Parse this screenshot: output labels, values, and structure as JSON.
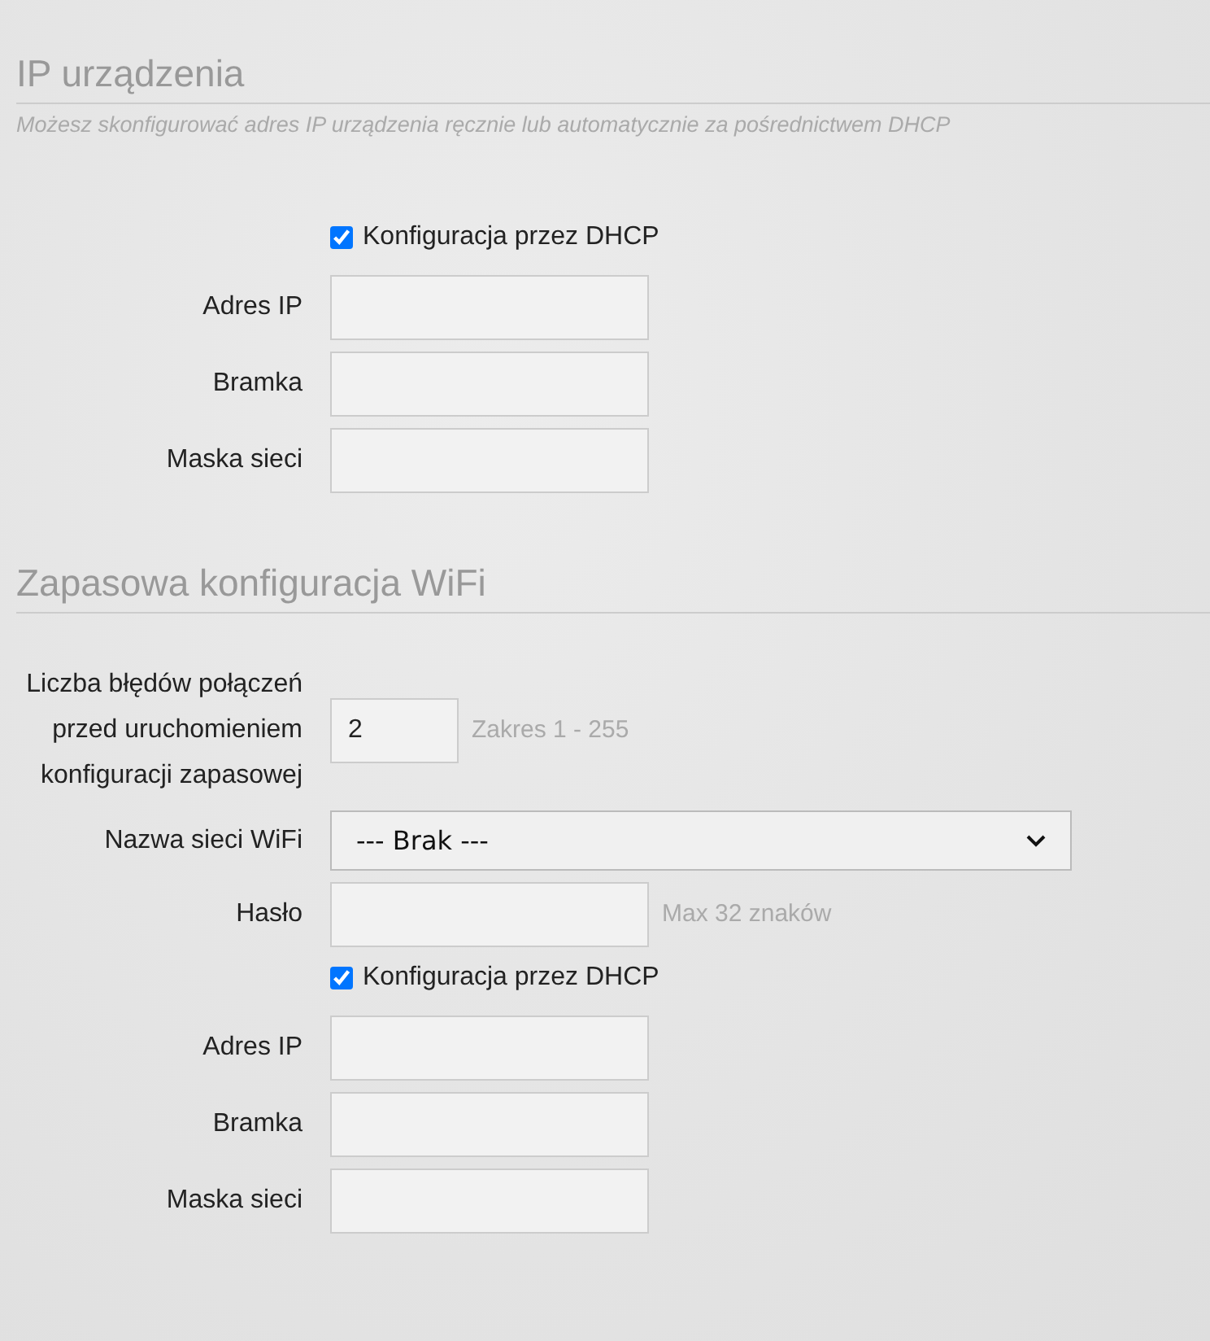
{
  "sections": [
    {
      "title": "IP urządzenia",
      "description": "Możesz skonfigurować adres IP urządzenia ręcznie lub automatycznie za pośrednictwem DHCP",
      "rows": [
        {
          "kind": "checkbox",
          "label": "Konfiguracja przez DHCP",
          "checked": true
        },
        {
          "kind": "text",
          "label": "Adres IP"
        },
        {
          "kind": "text",
          "label": "Bramka"
        },
        {
          "kind": "text",
          "label": "Maska sieci"
        }
      ]
    },
    {
      "title": "Zapasowa konfiguracja WiFi",
      "rows": [
        {
          "kind": "number",
          "label": "Liczba błędów połączeń przed uruchomieniem konfiguracji zapasowej",
          "value": "2",
          "hint": "Zakres 1 - 255"
        },
        {
          "kind": "select",
          "label": "Nazwa sieci WiFi",
          "value": "--- Brak ---"
        },
        {
          "kind": "text",
          "label": "Hasło",
          "hint": "Max 32 znaków"
        },
        {
          "kind": "checkbox",
          "label": "Konfiguracja przez DHCP",
          "checked": true
        },
        {
          "kind": "text",
          "label": "Adres IP"
        },
        {
          "kind": "text",
          "label": "Bramka"
        },
        {
          "kind": "text",
          "label": "Maska sieci"
        }
      ]
    }
  ]
}
